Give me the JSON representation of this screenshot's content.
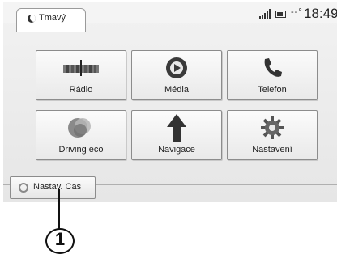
{
  "status_bar": {
    "profile_label": "Tmavý",
    "temperature": "--°",
    "clock": "18:49"
  },
  "tiles": [
    {
      "label": "Rádio",
      "icon": "radio-icon"
    },
    {
      "label": "Média",
      "icon": "media-play-icon"
    },
    {
      "label": "Telefon",
      "icon": "phone-icon"
    },
    {
      "label": "Driving eco",
      "icon": "driving-eco-icon"
    },
    {
      "label": "Navigace",
      "icon": "navigation-arrow-icon"
    },
    {
      "label": "Nastavení",
      "icon": "settings-gear-icon"
    }
  ],
  "bottom_bar": {
    "clock_setting_label": "Nastav. Cas"
  },
  "callout": {
    "number": "1"
  },
  "colors": {
    "play": "#3a3a3a",
    "eco": "#7a7a7a",
    "frame": "#8c8c8c"
  }
}
